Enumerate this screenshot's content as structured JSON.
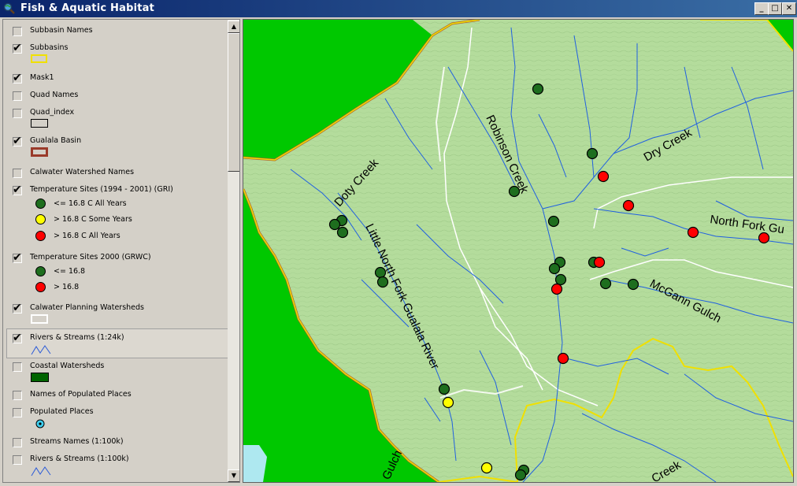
{
  "window": {
    "title": "Fish & Aquatic Habitat",
    "minimize_glyph": "_",
    "restore_glyph": "□",
    "close_glyph": "✕"
  },
  "toc": {
    "layers": [
      {
        "label": "Subbasin Names",
        "checked": false
      },
      {
        "label": "Subbasins",
        "checked": true,
        "symbol": "box-yellow-outline"
      },
      {
        "label": "Mask1",
        "checked": true
      },
      {
        "label": "Quad Names",
        "checked": false
      },
      {
        "label": "Quad_index",
        "checked": false,
        "symbol": "box-black-outline"
      },
      {
        "label": "Gualala Basin",
        "checked": true,
        "symbol": "box-brown-outline"
      },
      {
        "label": "Calwater Watershed Names",
        "checked": false
      },
      {
        "label": "Temperature Sites (1994 - 2001) (GRI)",
        "checked": true,
        "classes": [
          "<= 16.8 C All Years",
          "> 16.8 C Some Years",
          "> 16.8 C All Years"
        ]
      },
      {
        "label": "Temperature Sites 2000 (GRWC)",
        "checked": true,
        "classes": [
          "<= 16.8",
          "> 16.8"
        ]
      },
      {
        "label": "Calwater Planning Watersheds",
        "checked": true,
        "symbol": "box-white-outline"
      },
      {
        "label": "Rivers & Streams (1:24k)",
        "checked": true,
        "symbol": "blue-zigzag"
      },
      {
        "label": "Coastal Watersheds",
        "checked": false,
        "symbol": "box-green-fill"
      },
      {
        "label": "Names of Populated Places",
        "checked": false
      },
      {
        "label": "Populated Places",
        "checked": false,
        "symbol": "cyan-dot"
      },
      {
        "label": "Streams Names (1:100k)",
        "checked": false
      },
      {
        "label": "Rivers & Streams (1:100k)",
        "checked": false,
        "symbol": "blue-zigzag"
      }
    ]
  },
  "map": {
    "labels": {
      "robinson": "Robinson Creek",
      "dry": "Dry Creek",
      "doty": "Doty Creek",
      "little_north_fork": "Little North Fork Gualala River",
      "north_fork": "North Fork Gu",
      "mcgann": "McGann Gulch",
      "gulch": "Gulch",
      "creek_bottom": "Creek"
    },
    "colors": {
      "mask": "#00c800",
      "terrain": "#b4dc9c",
      "ocean": "#aee8f0",
      "stream": "#2060e0",
      "basin_boundary": "#f0e000",
      "basin_outline": "#b06030",
      "watershed_line": "#ffffff",
      "site_cool": "#1e6e1e",
      "site_some": "#ffff00",
      "site_warm": "#ff0000"
    }
  }
}
